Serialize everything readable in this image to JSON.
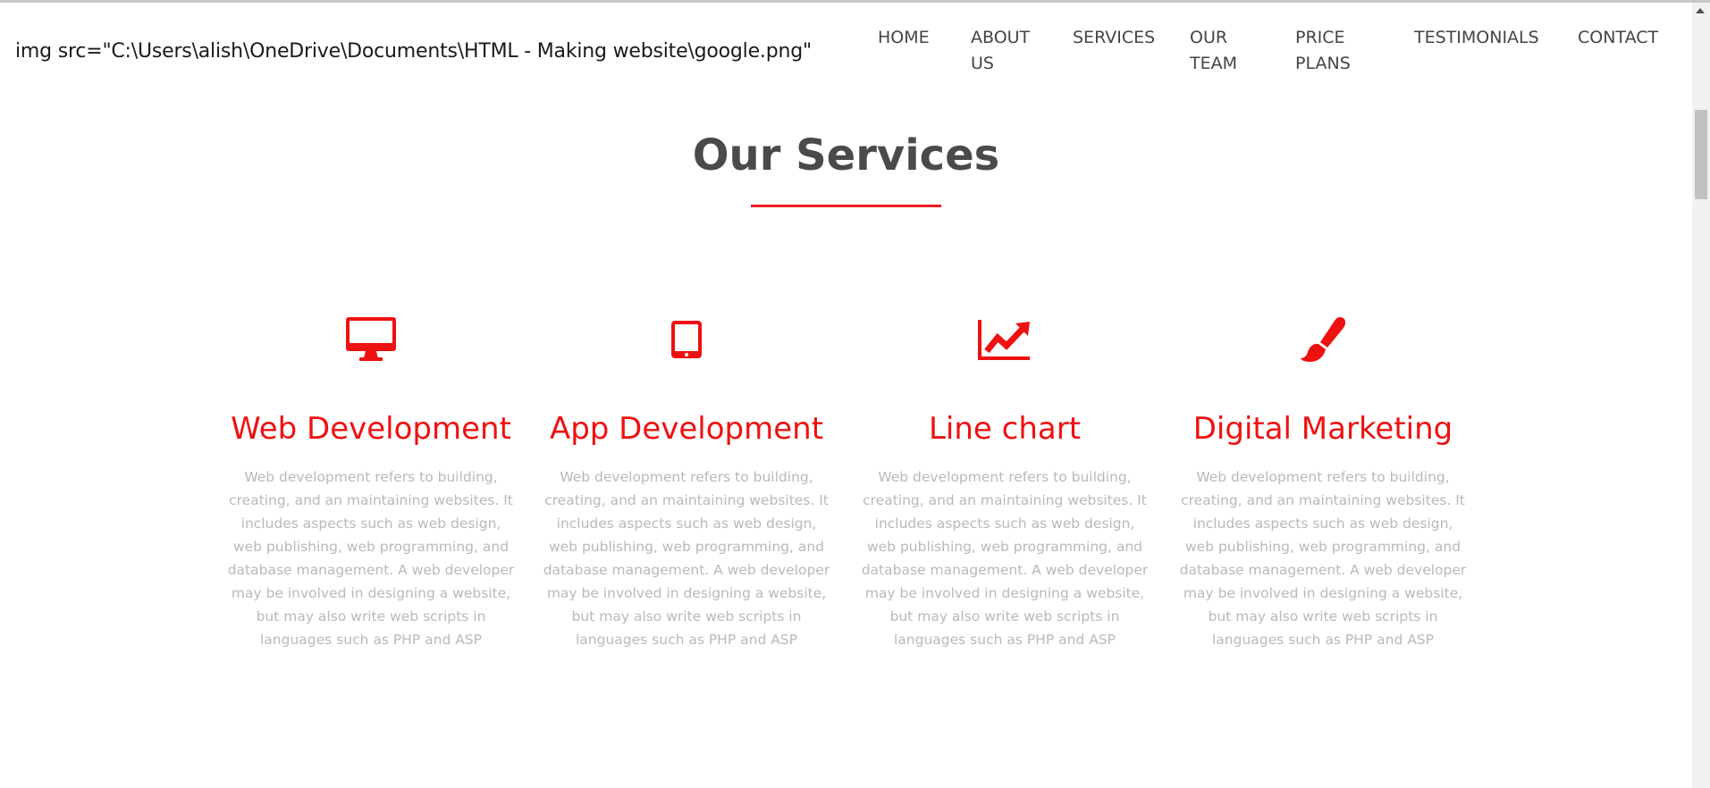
{
  "header": {
    "logo_text": "img src=\"C:\\Users\\alish\\OneDrive\\Documents\\HTML - Making website\\google.png\"",
    "nav": [
      {
        "label": "HOME"
      },
      {
        "label": "ABOUT US"
      },
      {
        "label": "SERVICES"
      },
      {
        "label": "OUR TEAM"
      },
      {
        "label": "PRICE PLANS"
      },
      {
        "label": "TESTIMONIALS"
      },
      {
        "label": "CONTACT"
      }
    ]
  },
  "section": {
    "title": "Our Services",
    "accent_color": "#ee1c24"
  },
  "services": [
    {
      "icon": "desktop-icon",
      "title": "Web Development",
      "description": "Web development refers to building, creating, and an maintaining websites. It includes aspects such as web design, web publishing, web programming, and database management. A web developer may be involved in designing a website, but may also write web scripts in languages such as PHP and ASP"
    },
    {
      "icon": "tablet-icon",
      "title": "App Development",
      "description": "Web development refers to building, creating, and an maintaining websites. It includes aspects such as web design, web publishing, web programming, and database management. A web developer may be involved in designing a website, but may also write web scripts in languages such as PHP and ASP"
    },
    {
      "icon": "line-chart-icon",
      "title": "Line chart",
      "description": "Web development refers to building, creating, and an maintaining websites. It includes aspects such as web design, web publishing, web programming, and database management. A web developer may be involved in designing a website, but may also write web scripts in languages such as PHP and ASP"
    },
    {
      "icon": "paint-brush-icon",
      "title": "Digital Marketing",
      "description": "Web development refers to building, creating, and an maintaining websites. It includes aspects such as web design, web publishing, web programming, and database management. A web developer may be involved in designing a website, but may also write web scripts in languages such as PHP and ASP"
    }
  ]
}
